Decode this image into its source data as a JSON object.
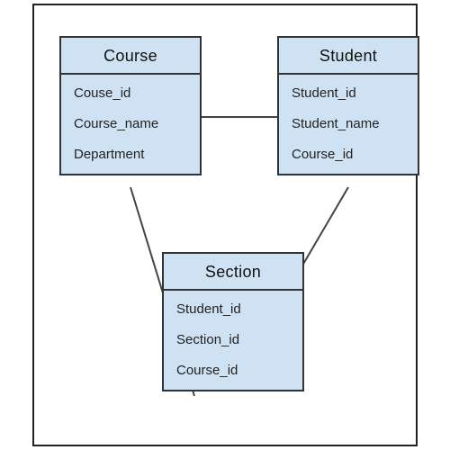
{
  "entities": {
    "course": {
      "title": "Course",
      "attrs": [
        "Couse_id",
        "Course_name",
        "Department"
      ]
    },
    "student": {
      "title": "Student",
      "attrs": [
        "Student_id",
        "Student_name",
        "Course_id"
      ]
    },
    "section": {
      "title": "Section",
      "attrs": [
        "Student_id",
        "Section_id",
        "Course_id"
      ]
    }
  },
  "relations": [
    {
      "from": "course",
      "to": "student"
    },
    {
      "from": "course",
      "to": "section"
    },
    {
      "from": "student",
      "to": "section"
    }
  ]
}
